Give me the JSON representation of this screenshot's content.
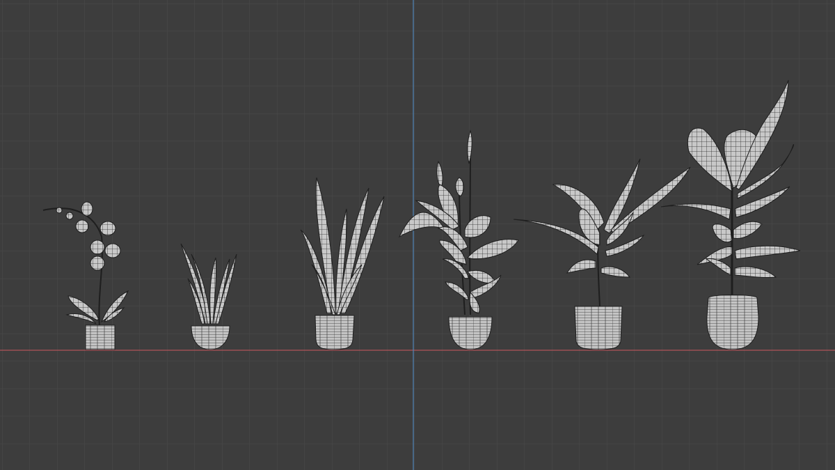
{
  "viewport": {
    "view": "front-orthographic",
    "shading": "wireframe",
    "colors": {
      "background": "#3d3d3d",
      "grid_line": "#4a4a4a",
      "x_axis": "#b0535a",
      "z_axis": "#4f86b8",
      "mesh_fill": "#c8c8c8",
      "mesh_wire": "#1e1e1e"
    }
  },
  "objects": [
    {
      "kind": "orchid",
      "icon": "orchid-plant"
    },
    {
      "kind": "small-snake-plant",
      "icon": "sansevieria-plant"
    },
    {
      "kind": "snake-plant",
      "icon": "sansevieria-plant"
    },
    {
      "kind": "peace-lily",
      "icon": "peace-lily-plant"
    },
    {
      "kind": "calathea",
      "icon": "broadleaf-plant"
    },
    {
      "kind": "rubber-plant",
      "icon": "ficus-plant"
    }
  ]
}
